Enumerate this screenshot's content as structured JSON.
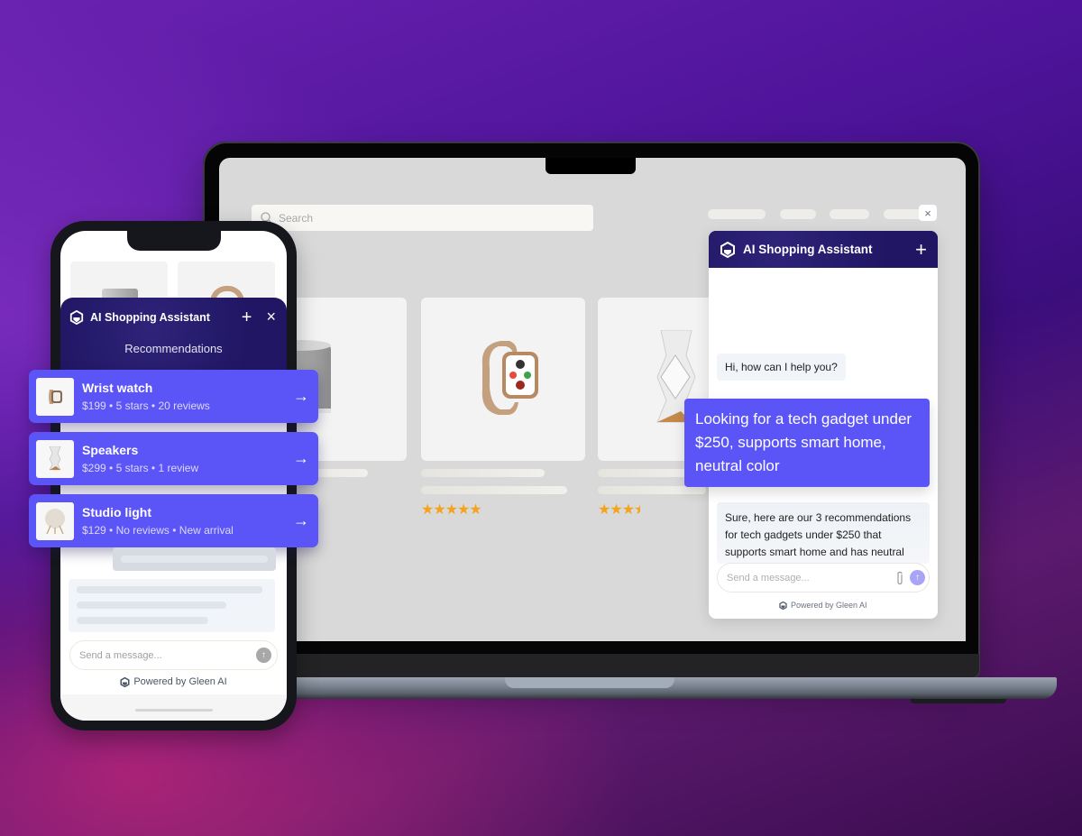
{
  "laptop": {
    "search": {
      "placeholder": "Search",
      "icon": "search-icon"
    },
    "close_icon": "×",
    "products": [
      {
        "name": "speaker-cylinder",
        "stars": "",
        "rating": null
      },
      {
        "name": "smart-watch",
        "stars": "★★★★★",
        "rating": 5
      },
      {
        "name": "tower-speaker",
        "stars": "★★★",
        "rating": 3.5
      }
    ],
    "chat": {
      "title": "AI Shopping Assistant",
      "new_chat_icon": "+",
      "bot_greeting": "Hi, how can I help you?",
      "user_message": "Looking for a tech gadget under $250, supports smart home, neutral color",
      "bot_reply": "Sure, here are our 3 recommendations for tech gadgets under $250 that supports smart home and has neutral",
      "input_placeholder": "Send a message...",
      "powered_by": "Powered by Gleen AI"
    }
  },
  "phone": {
    "chat": {
      "title": "AI Shopping Assistant",
      "new_chat_icon": "+",
      "close_icon": "×",
      "section_title": "Recommendations",
      "input_placeholder": "Send a message...",
      "powered_by": "Powered by Gleen AI"
    },
    "recommendations": [
      {
        "name": "Wrist watch",
        "meta": "$199  • 5 stars • 20 reviews",
        "thumb": "watch"
      },
      {
        "name": "Speakers",
        "meta": "$299 • 5 stars • 1 review",
        "thumb": "speaker"
      },
      {
        "name": "Studio light",
        "meta": "$129 • No reviews • New arrival",
        "thumb": "lamp"
      }
    ]
  },
  "colors": {
    "accent": "#5b54f7",
    "header": "#241a66",
    "star": "#f7a21b"
  }
}
